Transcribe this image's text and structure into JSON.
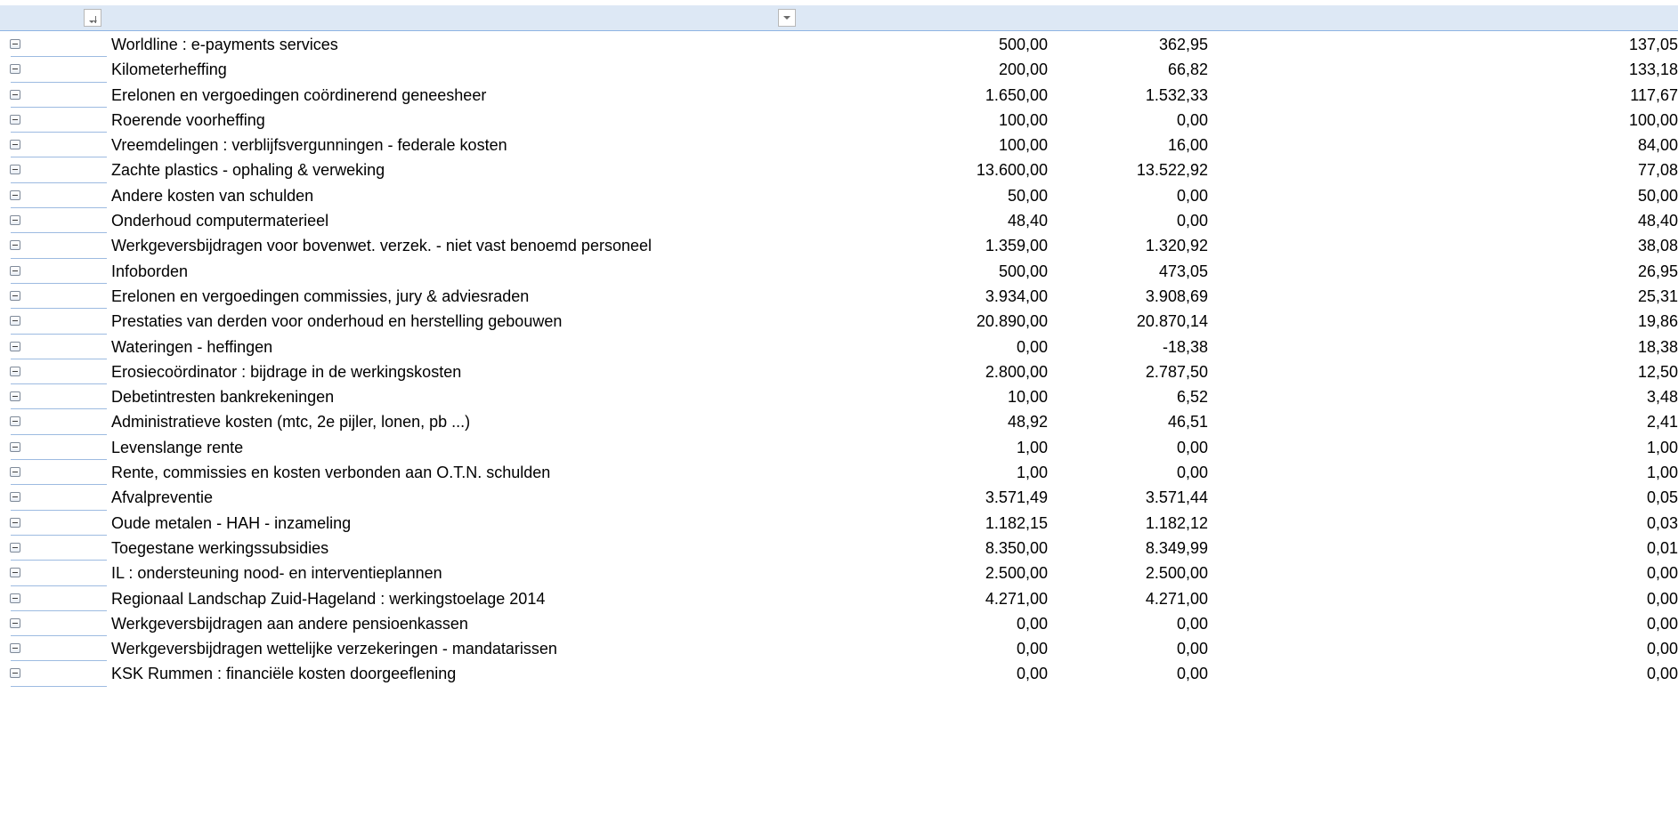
{
  "header": {
    "filter_buttons": [
      "sort-descending-filter",
      "filter-dropdown"
    ]
  },
  "rows": [
    {
      "label": "Worldline : e-payments services",
      "budget": "500,00",
      "spent": "362,95",
      "remaining": "137,05"
    },
    {
      "label": "Kilometerheffing",
      "budget": "200,00",
      "spent": "66,82",
      "remaining": "133,18"
    },
    {
      "label": "Erelonen en vergoedingen coördinerend geneesheer",
      "budget": "1.650,00",
      "spent": "1.532,33",
      "remaining": "117,67"
    },
    {
      "label": "Roerende voorheffing",
      "budget": "100,00",
      "spent": "0,00",
      "remaining": "100,00"
    },
    {
      "label": "Vreemdelingen : verblijfsvergunningen - federale kosten",
      "budget": "100,00",
      "spent": "16,00",
      "remaining": "84,00"
    },
    {
      "label": "Zachte plastics - ophaling & verweking",
      "budget": "13.600,00",
      "spent": "13.522,92",
      "remaining": "77,08"
    },
    {
      "label": "Andere kosten van schulden",
      "budget": "50,00",
      "spent": "0,00",
      "remaining": "50,00"
    },
    {
      "label": "Onderhoud computermaterieel",
      "budget": "48,40",
      "spent": "0,00",
      "remaining": "48,40"
    },
    {
      "label": "Werkgeversbijdragen voor bovenwet. verzek. - niet vast benoemd personeel",
      "budget": "1.359,00",
      "spent": "1.320,92",
      "remaining": "38,08"
    },
    {
      "label": "Infoborden",
      "budget": "500,00",
      "spent": "473,05",
      "remaining": "26,95"
    },
    {
      "label": "Erelonen en vergoedingen commissies, jury & adviesraden",
      "budget": "3.934,00",
      "spent": "3.908,69",
      "remaining": "25,31"
    },
    {
      "label": "Prestaties van derden voor onderhoud en herstelling gebouwen",
      "budget": "20.890,00",
      "spent": "20.870,14",
      "remaining": "19,86"
    },
    {
      "label": "Wateringen - heffingen",
      "budget": "0,00",
      "spent": "-18,38",
      "remaining": "18,38"
    },
    {
      "label": "Erosiecoördinator : bijdrage in de werkingskosten",
      "budget": "2.800,00",
      "spent": "2.787,50",
      "remaining": "12,50"
    },
    {
      "label": "Debetintresten bankrekeningen",
      "budget": "10,00",
      "spent": "6,52",
      "remaining": "3,48"
    },
    {
      "label": "Administratieve kosten (mtc, 2e pijler, lonen, pb ...)",
      "budget": "48,92",
      "spent": "46,51",
      "remaining": "2,41"
    },
    {
      "label": "Levenslange rente",
      "budget": "1,00",
      "spent": "0,00",
      "remaining": "1,00"
    },
    {
      "label": "Rente, commissies en kosten verbonden aan O.T.N. schulden",
      "budget": "1,00",
      "spent": "0,00",
      "remaining": "1,00"
    },
    {
      "label": "Afvalpreventie",
      "budget": "3.571,49",
      "spent": "3.571,44",
      "remaining": "0,05"
    },
    {
      "label": "Oude metalen - HAH - inzameling",
      "budget": "1.182,15",
      "spent": "1.182,12",
      "remaining": "0,03"
    },
    {
      "label": "Toegestane werkingssubsidies",
      "budget": "8.350,00",
      "spent": "8.349,99",
      "remaining": "0,01"
    },
    {
      "label": "IL : ondersteuning nood- en interventieplannen",
      "budget": "2.500,00",
      "spent": "2.500,00",
      "remaining": "0,00"
    },
    {
      "label": "Regionaal Landschap Zuid-Hageland : werkingstoelage 2014",
      "budget": "4.271,00",
      "spent": "4.271,00",
      "remaining": "0,00"
    },
    {
      "label": "Werkgeversbijdragen aan andere pensioenkassen",
      "budget": "0,00",
      "spent": "0,00",
      "remaining": "0,00"
    },
    {
      "label": "Werkgeversbijdragen wettelijke verzekeringen - mandatarissen",
      "budget": "0,00",
      "spent": "0,00",
      "remaining": "0,00"
    },
    {
      "label": "KSK Rummen : financiële kosten doorgeeflening",
      "budget": "0,00",
      "spent": "0,00",
      "remaining": "0,00"
    }
  ]
}
